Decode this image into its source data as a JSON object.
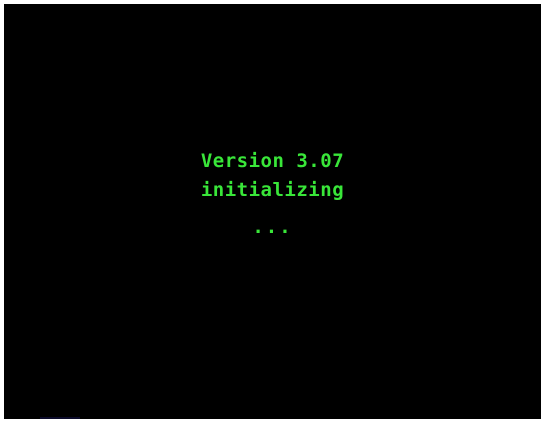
{
  "boot_screen": {
    "version_line": "Version 3.07",
    "status_line": "initializing",
    "progress_dots": "...",
    "background_color": "#000000",
    "text_color": "#39e639"
  }
}
